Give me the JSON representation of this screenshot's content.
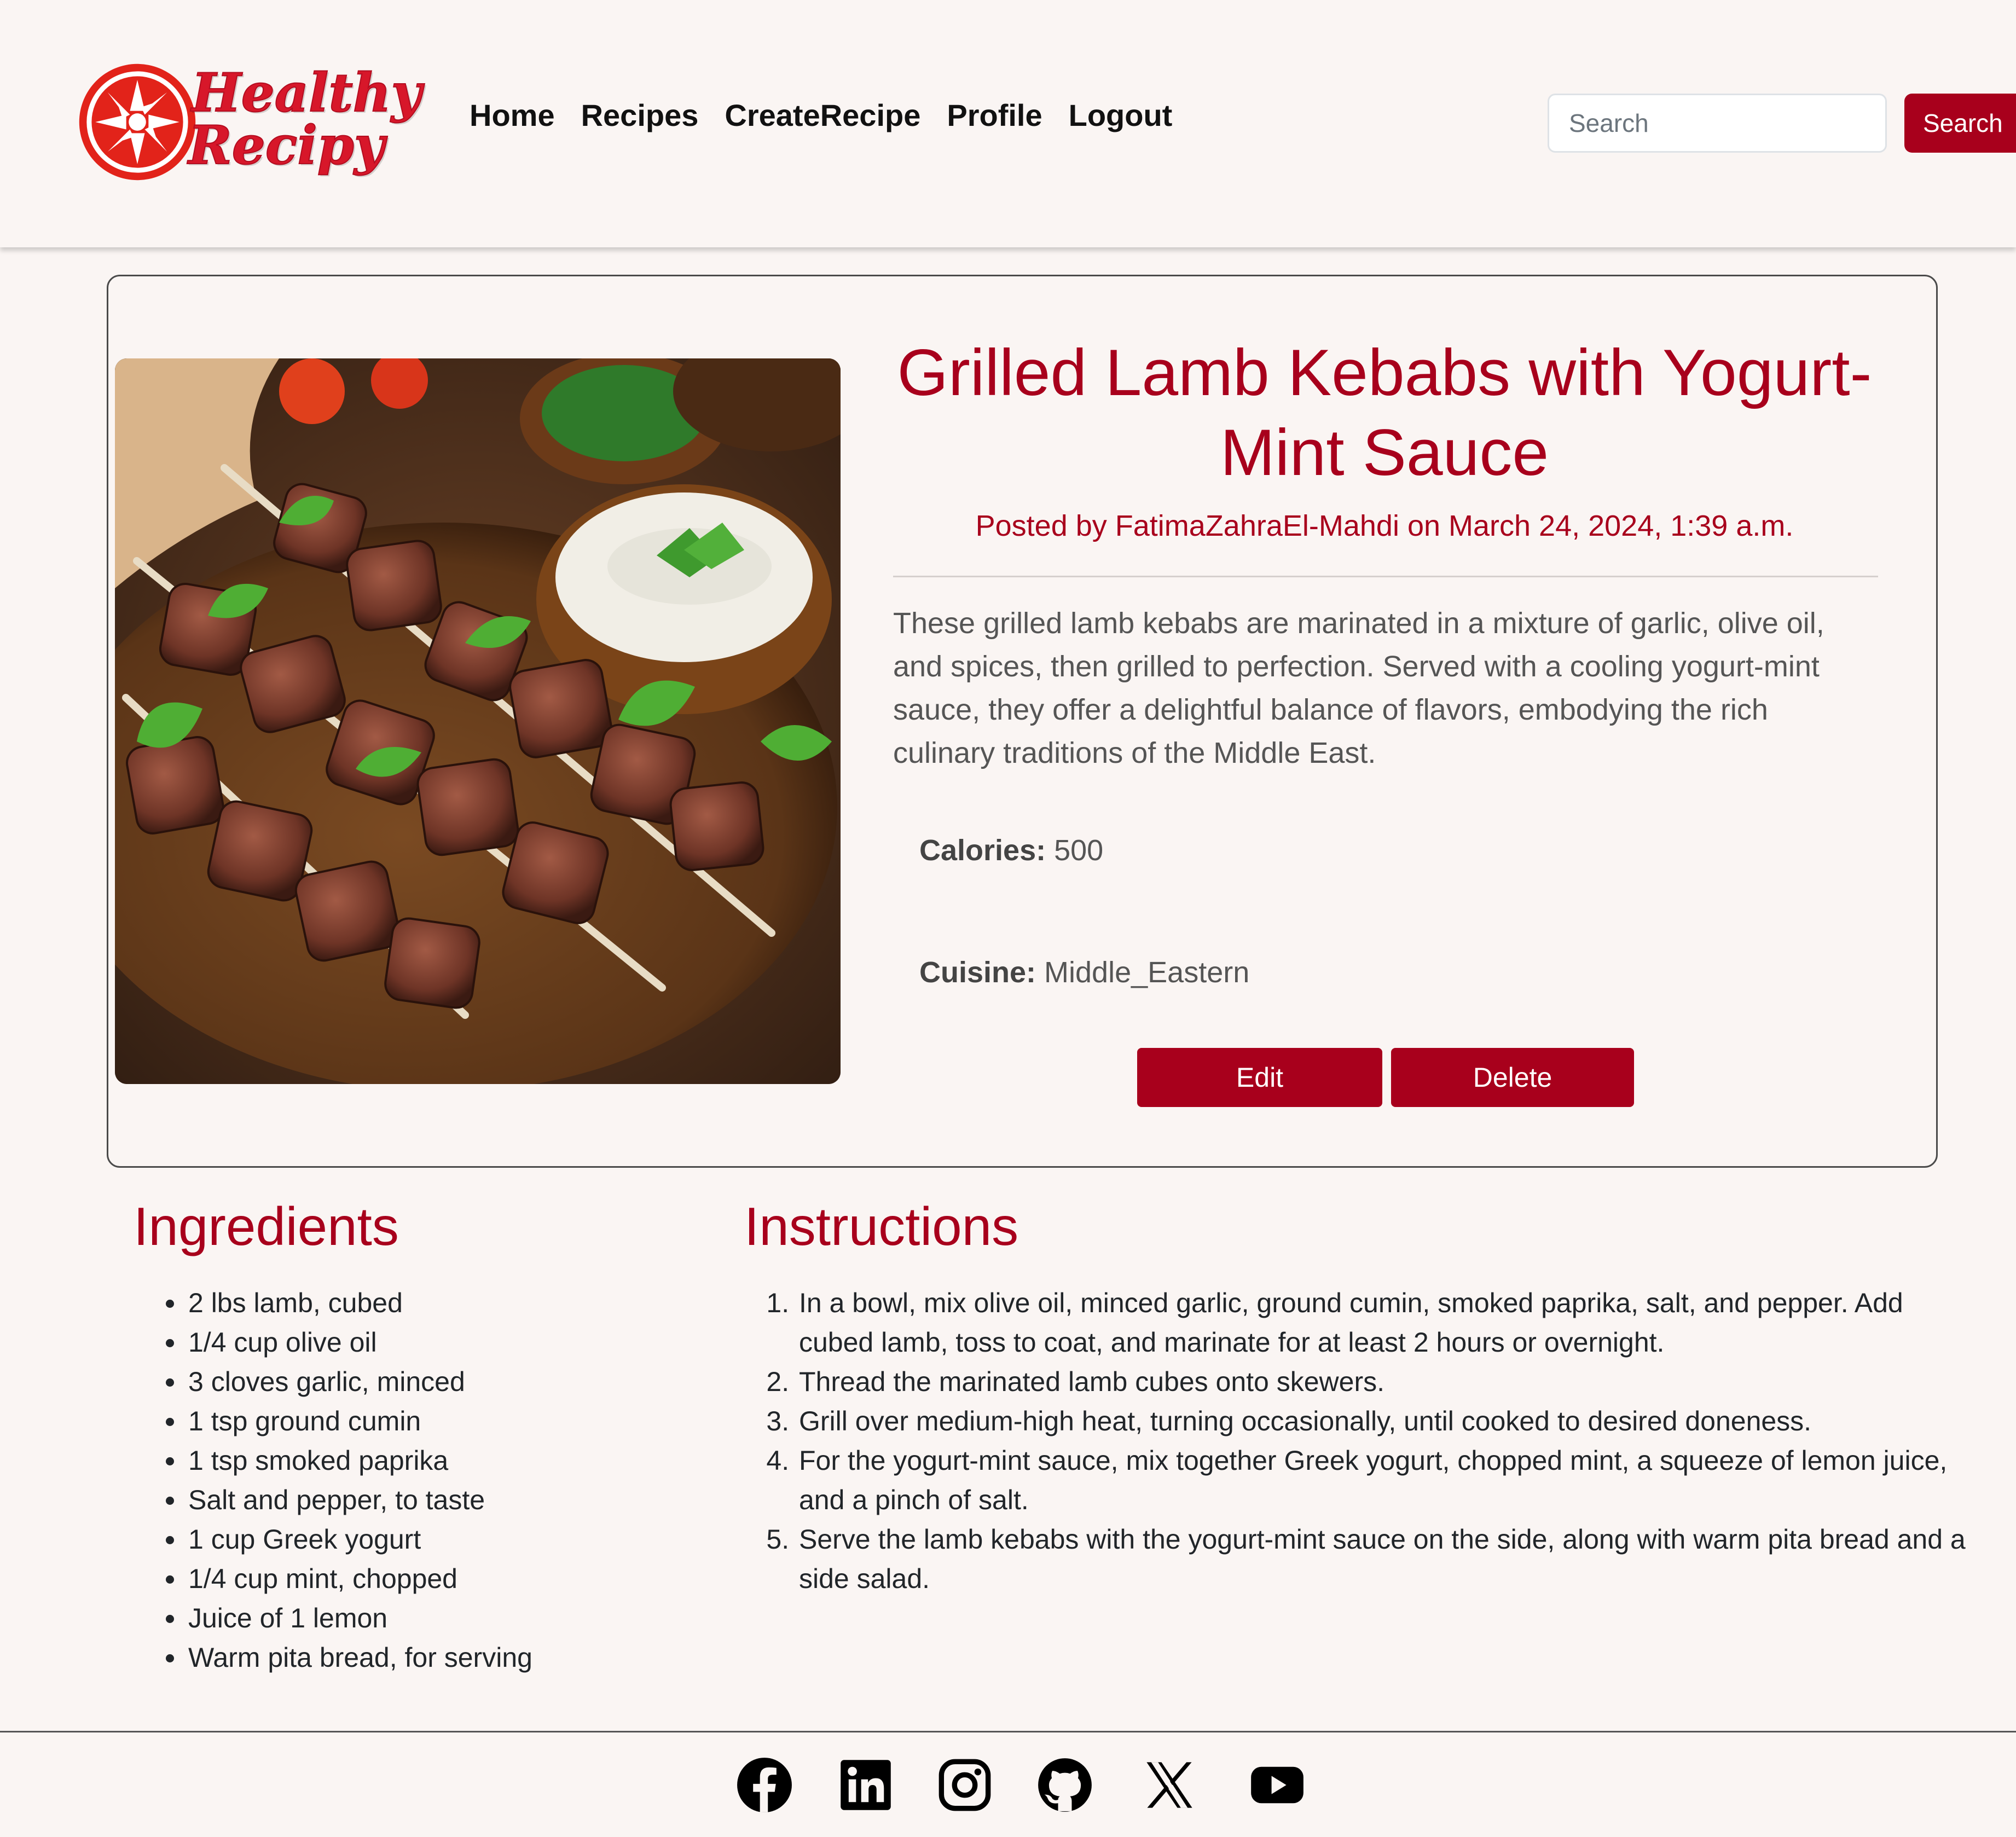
{
  "brand": {
    "line1": "Healthy",
    "line2": "Recipy",
    "color": "#d7172a"
  },
  "nav": {
    "links": [
      "Home",
      "Recipes",
      "CreateRecipe",
      "Profile",
      "Logout"
    ],
    "search_placeholder": "Search",
    "search_button": "Search"
  },
  "recipe": {
    "image_alt": "Grilled lamb kebabs on a plate with yogurt-mint sauce",
    "title": "Grilled Lamb Kebabs with Yogurt-Mint Sauce",
    "posted_by": "Posted by FatimaZahraEl-Mahdi on March 24, 2024, 1:39 a.m.",
    "description": "These grilled lamb kebabs are marinated in a mixture of garlic, olive oil, and spices, then grilled to perfection. Served with a cooling yogurt-mint sauce, they offer a delightful balance of flavors, embodying the rich culinary traditions of the Middle East.",
    "calories_label": "Calories:",
    "calories_value": "500",
    "cuisine_label": "Cuisine:",
    "cuisine_value": "Middle_Eastern",
    "edit_button": "Edit",
    "delete_button": "Delete"
  },
  "ingredients": {
    "heading": "Ingredients",
    "items": [
      "2 lbs lamb, cubed",
      "1/4 cup olive oil",
      "3 cloves garlic, minced",
      "1 tsp ground cumin",
      "1 tsp smoked paprika",
      "Salt and pepper, to taste",
      "1 cup Greek yogurt",
      "1/4 cup mint, chopped",
      "Juice of 1 lemon",
      "Warm pita bread, for serving"
    ]
  },
  "instructions": {
    "heading": "Instructions",
    "items": [
      "In a bowl, mix olive oil, minced garlic, ground cumin, smoked paprika, salt, and pepper. Add cubed lamb, toss to coat, and marinate for at least 2 hours or overnight.",
      "Thread the marinated lamb cubes onto skewers.",
      "Grill over medium-high heat, turning occasionally, until cooked to desired doneness.",
      "For the yogurt-mint sauce, mix together Greek yogurt, chopped mint, a squeeze of lemon juice, and a pinch of salt.",
      "Serve the lamb kebabs with the yogurt-mint sauce on the side, along with warm pita bread and a side salad."
    ]
  },
  "footer": {
    "icons": [
      "facebook-icon",
      "linkedin-icon",
      "instagram-icon",
      "github-icon",
      "x-icon",
      "youtube-icon"
    ]
  },
  "colors": {
    "accent": "#a8001c",
    "background": "#faf5f3"
  }
}
